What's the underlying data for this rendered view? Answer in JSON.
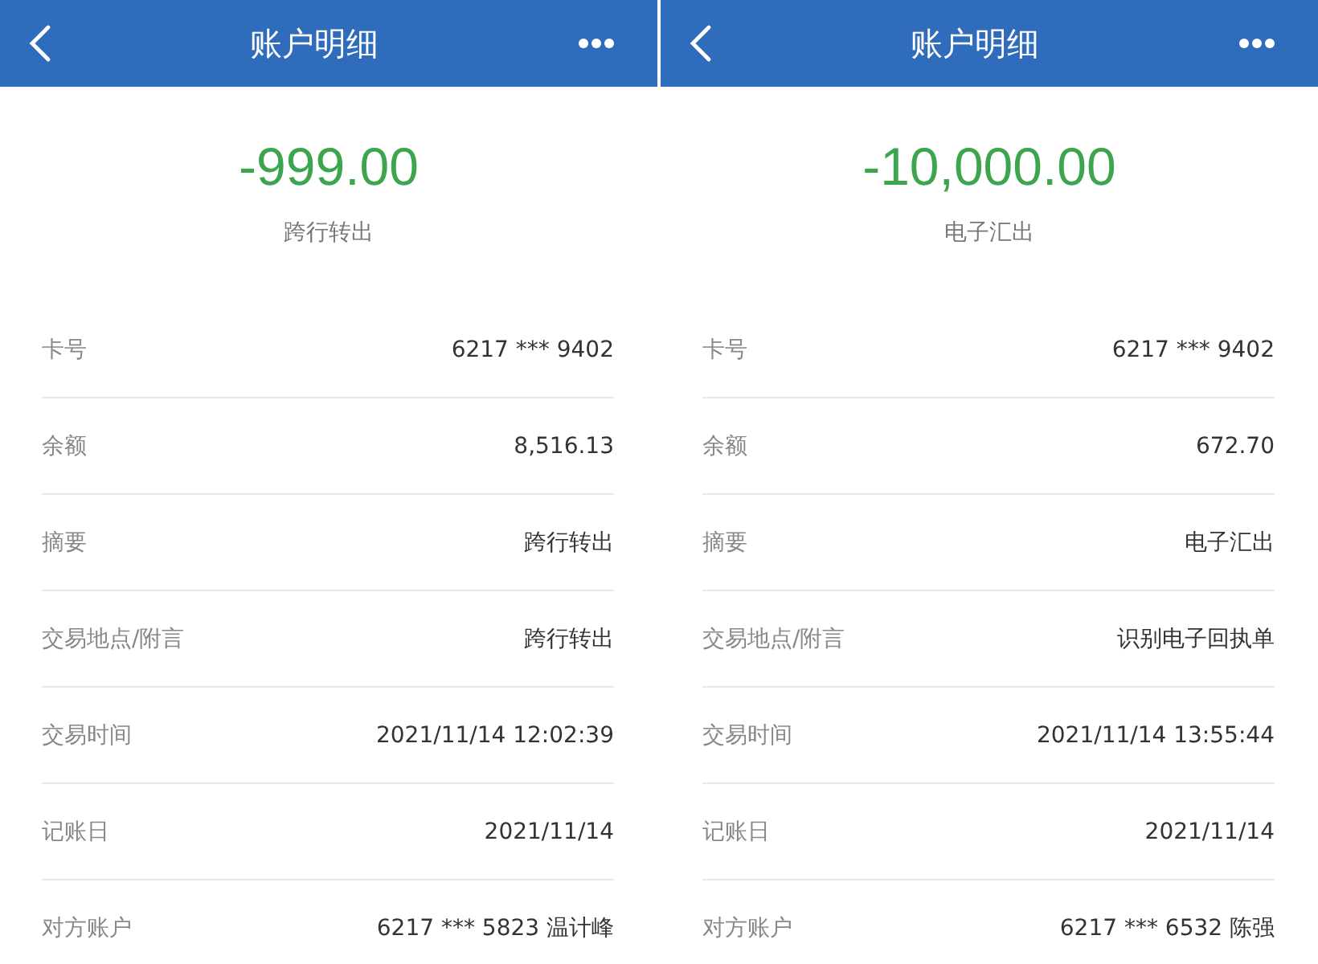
{
  "screens": [
    {
      "header": {
        "title": "账户明细"
      },
      "amount": "-999.00",
      "type": "跨行转出",
      "rows": [
        {
          "label": "卡号",
          "value": "6217 *** 9402"
        },
        {
          "label": "余额",
          "value": "8,516.13"
        },
        {
          "label": "摘要",
          "value": "跨行转出"
        },
        {
          "label": "交易地点/附言",
          "value": "跨行转出"
        },
        {
          "label": "交易时间",
          "value": "2021/11/14 12:02:39"
        },
        {
          "label": "记账日",
          "value": "2021/11/14"
        },
        {
          "label": "对方账户",
          "value": "6217 *** 5823 温计峰"
        }
      ]
    },
    {
      "header": {
        "title": "账户明细"
      },
      "amount": "-10,000.00",
      "type": "电子汇出",
      "rows": [
        {
          "label": "卡号",
          "value": "6217 *** 9402"
        },
        {
          "label": "余额",
          "value": "672.70"
        },
        {
          "label": "摘要",
          "value": "电子汇出"
        },
        {
          "label": "交易地点/附言",
          "value": "识别电子回执单"
        },
        {
          "label": "交易时间",
          "value": "2021/11/14 13:55:44"
        },
        {
          "label": "记账日",
          "value": "2021/11/14"
        },
        {
          "label": "对方账户",
          "value": "6217 *** 6532 陈强"
        }
      ]
    }
  ]
}
